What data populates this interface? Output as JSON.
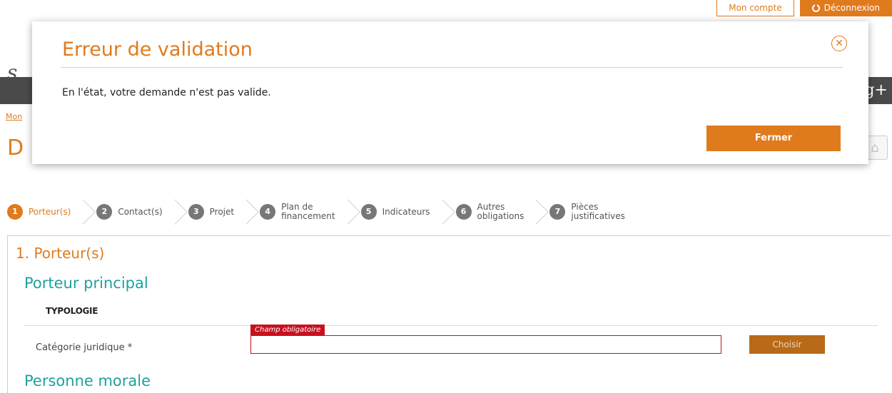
{
  "header": {
    "account_label": "Mon compte",
    "logout_label": "Déconnexion",
    "logo_partial": "s",
    "social_partial": "g+",
    "breadcrumb_partial": "Mon",
    "page_title_partial": "D"
  },
  "stepper": {
    "steps": [
      {
        "num": "1",
        "label": "Porteur(s)",
        "active": true
      },
      {
        "num": "2",
        "label": "Contact(s)",
        "active": false
      },
      {
        "num": "3",
        "label": "Projet",
        "active": false
      },
      {
        "num": "4",
        "label": "Plan de\nfinancement",
        "active": false
      },
      {
        "num": "5",
        "label": "Indicateurs",
        "active": false
      },
      {
        "num": "6",
        "label": "Autres\nobligations",
        "active": false
      },
      {
        "num": "7",
        "label": "Pièces\njustificatives",
        "active": false
      }
    ]
  },
  "form": {
    "section_title": "1. Porteur(s)",
    "subsection_title": "Porteur principal",
    "group_label": "TYPOLOGIE",
    "categorie_label": "Catégorie juridique *",
    "required_badge": "Champ obligatoire",
    "categorie_value": "",
    "choose_button": "Choisir",
    "next_subsection_title": "Personne morale"
  },
  "modal": {
    "title": "Erreur de validation",
    "message": "En l'état, votre demande n'est pas valide.",
    "close_button": "Fermer",
    "close_icon": "circle-x-icon"
  },
  "colors": {
    "accent": "#e07b1d",
    "teal": "#20a0a0",
    "error": "#c8101e"
  }
}
